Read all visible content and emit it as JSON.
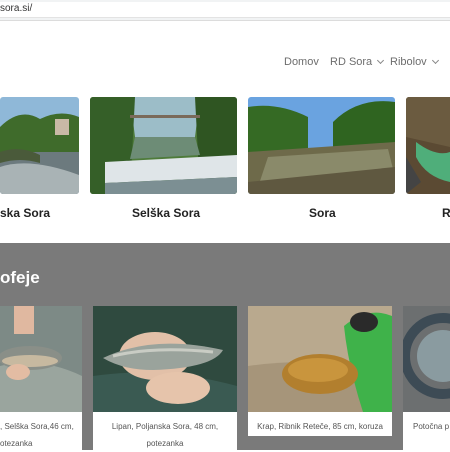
{
  "browser": {
    "url": "sora.si/"
  },
  "nav": {
    "items": [
      {
        "label": "Domov",
        "has_dropdown": false
      },
      {
        "label": "RD Sora",
        "has_dropdown": true
      },
      {
        "label": "Ribolov",
        "has_dropdown": true
      }
    ]
  },
  "rivers": [
    {
      "title": "ska Sora"
    },
    {
      "title": "Selška Sora"
    },
    {
      "title": "Sora"
    },
    {
      "title": "R"
    }
  ],
  "trophies_section": {
    "heading": "ofeje",
    "items": [
      {
        "line1": ", Selška Sora,46 cm,",
        "line2": "otezanka"
      },
      {
        "line1": "Lipan, Poljanska Sora, 48 cm,",
        "line2": "potezanka"
      },
      {
        "line1": "Krap, Ribnik Reteče, 85 cm, koruza",
        "line2": ""
      },
      {
        "line1": "Potočna p",
        "line2": ""
      }
    ]
  },
  "colors": {
    "band": "#7a7a7a",
    "nav_text": "#6d6d6d",
    "heading_text": "#ffffff"
  }
}
